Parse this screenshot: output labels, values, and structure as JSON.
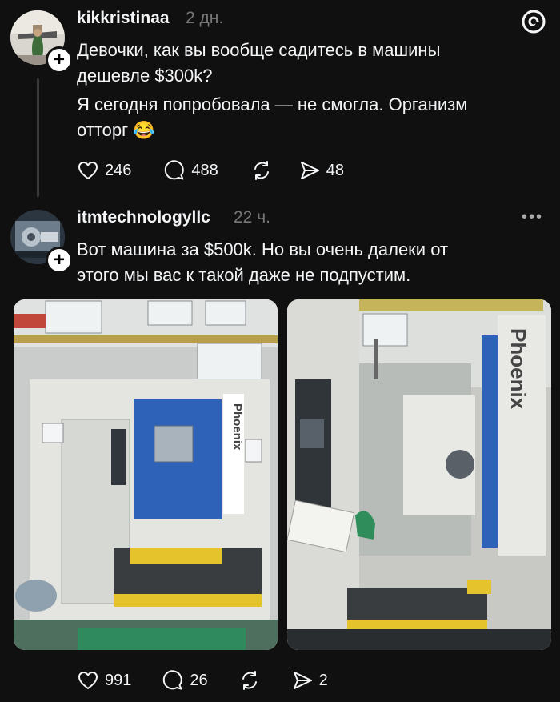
{
  "post1": {
    "username": "kikkristinaa",
    "time": "2 дн.",
    "text_line1": "Девочки, как вы вообще садитесь в машины\nдешевле $300k?",
    "text_line2": "Я сегодня попробовала — не смогла. Организм\nотторг",
    "emoji": "😂",
    "likes": "246",
    "comments": "488",
    "shares": "48"
  },
  "post2": {
    "username": "itmtechnologyllc",
    "time": "22 ч.",
    "text": "Вот машина за $500k. Но вы очень далеки от\nэтого мы вас к такой даже не подпустим.",
    "photo_brand": "Phoenix",
    "likes": "991",
    "comments": "26",
    "shares": "2"
  },
  "icons": {
    "like": "heart-icon",
    "comment": "comment-icon",
    "repost": "repost-icon",
    "share": "send-icon",
    "logo": "threads-logo-icon",
    "more": "more-icon"
  },
  "colors": {
    "background": "#101010",
    "text": "#f3f5f7",
    "muted": "#777777",
    "machine_blue": "#2d62b8"
  }
}
